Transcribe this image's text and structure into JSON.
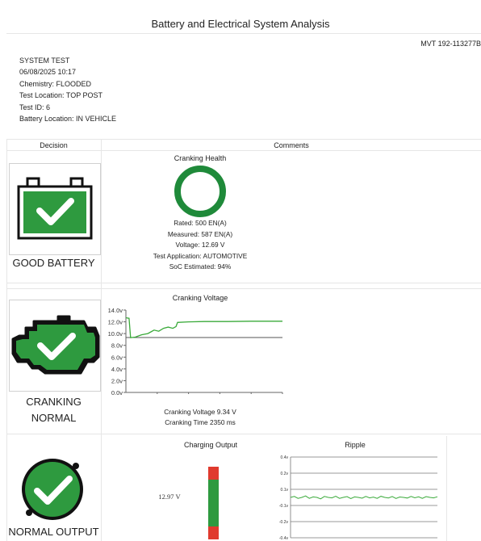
{
  "report": {
    "title": "Battery and Electrical System Analysis",
    "mvt": "MVT  192-113277B"
  },
  "meta": {
    "mode": "SYSTEM TEST",
    "datetime": "06/08/2025 10:17",
    "chemistry": "Chemistry: FLOODED",
    "test_location": "Test Location: TOP POST",
    "test_id": "Test ID: 6",
    "battery_location": "Battery Location: IN VEHICLE"
  },
  "table": {
    "decision_header": "Decision",
    "comments_header": "Comments"
  },
  "battery": {
    "decision": "GOOD BATTERY",
    "cranking_health_title": "Cranking Health",
    "rated": "Rated: 500 EN(A)",
    "measured": "Measured: 587 EN(A)",
    "voltage": "Voltage: 12.69 V",
    "application": "Test Application: AUTOMOTIVE",
    "soc": "SoC Estimated: 94%",
    "colors": {
      "ok": "#2e9a3f",
      "ring": "#1f8a3a"
    }
  },
  "cranking": {
    "decision_line1": "CRANKING",
    "decision_line2": "NORMAL",
    "chart_title": "Cranking Voltage",
    "voltage_text": "Cranking Voltage 9.34 V",
    "time_text": "Cranking Time 2350 ms"
  },
  "charging": {
    "decision": "NORMAL OUTPUT",
    "output_title": "Charging Output",
    "output_value": "12.97 V",
    "ripple_title": "Ripple"
  },
  "chart_data": [
    {
      "type": "line",
      "title": "Cranking Voltage",
      "y_ticks": [
        "14.0v",
        "12.0v",
        "10.0v",
        "8.0v",
        "6.0v",
        "4.0v",
        "2.0v",
        "0.0v"
      ],
      "ylim": [
        0,
        14
      ],
      "series": [
        {
          "values": [
            [
              0,
              12.7
            ],
            [
              0.02,
              12.6
            ],
            [
              0.03,
              9.3
            ],
            [
              0.06,
              9.4
            ],
            [
              0.1,
              9.8
            ],
            [
              0.14,
              10.0
            ],
            [
              0.16,
              10.3
            ],
            [
              0.18,
              10.6
            ],
            [
              0.21,
              10.4
            ],
            [
              0.24,
              10.9
            ],
            [
              0.27,
              11.1
            ],
            [
              0.3,
              10.9
            ],
            [
              0.32,
              11.2
            ],
            [
              0.33,
              11.9
            ],
            [
              0.4,
              12.0
            ],
            [
              0.5,
              12.05
            ],
            [
              0.65,
              12.05
            ],
            [
              0.8,
              12.1
            ],
            [
              1.0,
              12.1
            ]
          ]
        }
      ],
      "reference_line": 9.34,
      "colors": {
        "line": "#3aaa3a",
        "reference": "#555555"
      }
    },
    {
      "type": "line",
      "title": "Ripple",
      "y_ticks": [
        "0.4v",
        "0.2v",
        "0.1v",
        "-0.1v",
        "-0.2v",
        "-0.4v"
      ],
      "grid": true,
      "series": [
        {
          "values": [
            0.0,
            0.01,
            -0.01,
            0.0,
            0.015,
            -0.01,
            0.005,
            0.0,
            -0.015,
            0.01,
            0.0,
            -0.005,
            0.012,
            -0.01,
            0.0,
            0.008,
            -0.012,
            0.005,
            0.0,
            -0.008,
            0.01,
            -0.005,
            0.003,
            -0.01,
            0.012,
            0.0,
            -0.006,
            0.009,
            -0.011,
            0.004,
            0.0,
            -0.007,
            0.01,
            -0.004,
            0.006,
            -0.01,
            0.008,
            0.0,
            -0.005,
            0.007
          ]
        }
      ],
      "colors": {
        "line": "#3aaa3a",
        "grid": "#777777"
      }
    }
  ]
}
